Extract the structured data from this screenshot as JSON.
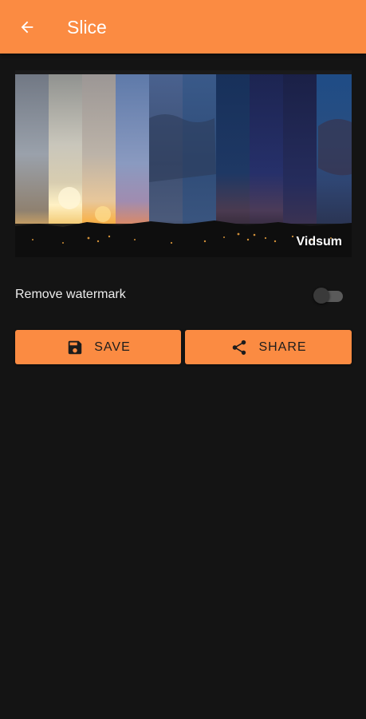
{
  "colors": {
    "accent": "#fb8b42",
    "background": "#141414",
    "text": "#ececec"
  },
  "appbar": {
    "title": "Slice",
    "back_icon": "arrow-left-icon"
  },
  "preview": {
    "watermark": "Vidsum"
  },
  "settings": {
    "remove_watermark_label": "Remove watermark",
    "remove_watermark_enabled": false
  },
  "actions": {
    "save_label": "SAVE",
    "save_icon": "floppy-disk-icon",
    "share_label": "SHARE",
    "share_icon": "share-icon"
  }
}
